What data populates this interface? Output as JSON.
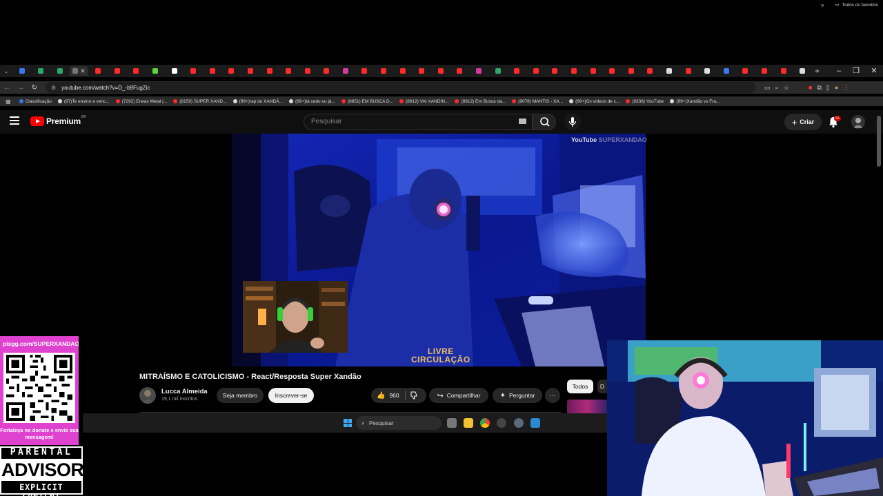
{
  "browser": {
    "tabs": [
      {
        "color": "#3a78f2"
      },
      {
        "color": "#2aa96a"
      },
      {
        "color": "#2aa96a"
      },
      {
        "color": "#777777",
        "active": true
      },
      {
        "color": "#ff2a2a"
      },
      {
        "color": "#ff2a2a"
      },
      {
        "color": "#ff2a2a"
      },
      {
        "color": "#5ed63a"
      },
      {
        "color": "#ffffff"
      },
      {
        "color": "#ff2a2a"
      },
      {
        "color": "#ff2a2a"
      },
      {
        "color": "#ff2a2a"
      },
      {
        "color": "#ff2a2a"
      },
      {
        "color": "#ff2a2a"
      },
      {
        "color": "#ff2a2a"
      },
      {
        "color": "#ff2a2a"
      },
      {
        "color": "#ff2a2a"
      },
      {
        "color": "#d63aa0"
      },
      {
        "color": "#ff2a2a"
      },
      {
        "color": "#ff2a2a"
      },
      {
        "color": "#ff2a2a"
      },
      {
        "color": "#ff2a2a"
      },
      {
        "color": "#ff2a2a"
      },
      {
        "color": "#ff2a2a"
      },
      {
        "color": "#d63aa0"
      },
      {
        "color": "#2aa96a"
      },
      {
        "color": "#ff2a2a"
      },
      {
        "color": "#ff2a2a"
      },
      {
        "color": "#ff2a2a"
      },
      {
        "color": "#ff2a2a"
      },
      {
        "color": "#ff2a2a"
      },
      {
        "color": "#ff2a2a"
      },
      {
        "color": "#ff2a2a"
      },
      {
        "color": "#ff2a2a"
      },
      {
        "color": "#dddddd"
      },
      {
        "color": "#ff2a2a"
      },
      {
        "color": "#dddddd"
      },
      {
        "color": "#3a78f2"
      },
      {
        "color": "#ff2a2a"
      },
      {
        "color": "#ff2a2a"
      },
      {
        "color": "#ff2a2a"
      },
      {
        "color": "#dddddd"
      }
    ],
    "new_tab": "+",
    "window": {
      "minimize": "–",
      "maximize": "❐",
      "close": "✕"
    },
    "url": "youtube.com/watch?v=D_-b9FugZic",
    "bookmarks": [
      {
        "label": "Classificação",
        "color": "#3a78f2"
      },
      {
        "label": "(97)Te ensino a venc...",
        "color": "#dddddd"
      },
      {
        "label": "(7292) Eneas Metal |...",
        "color": "#ff2a2a"
      },
      {
        "label": "(8159) SUPER XAND...",
        "color": "#ff2a2a"
      },
      {
        "label": "(99+)rap do XANDÃ...",
        "color": "#dddddd"
      },
      {
        "label": "(99+)tá cedo ou já...",
        "color": "#dddddd"
      },
      {
        "label": "(8851) EM BUSCA D...",
        "color": "#ff2a2a"
      },
      {
        "label": "(8912) VAI XANDIN...",
        "color": "#ff2a2a"
      },
      {
        "label": "(8912) Em Busca da...",
        "color": "#ff2a2a"
      },
      {
        "label": "(9078) MANTIS - XA...",
        "color": "#ff2a2a"
      },
      {
        "label": "(99+)Os vídeos de c...",
        "color": "#dddddd"
      },
      {
        "label": "(9338) YouTube",
        "color": "#ff2a2a"
      },
      {
        "label": "(99+)Xandão vs Fra...",
        "color": "#dddddd"
      }
    ],
    "bookmarks_more": "»",
    "all_bookmarks": "Todos os favoritos"
  },
  "youtube": {
    "logo_word": "Premium",
    "logo_region": "BR",
    "search_placeholder": "Pesquisar",
    "create_label": "Criar",
    "notifications_badge": "9+",
    "video_watermark_1": "You",
    "video_watermark_2": "Tube",
    "video_watermark_channel": "SUPERXANDAO",
    "video_overlay_line1": "LIVRE",
    "video_overlay_line2": "CIRCULAÇÃO",
    "video_title": "MITRAÍSMO E CATOLICISMO - React/Resposta Super Xandão",
    "channel_name": "Lucca Almeida",
    "subscribers": "19,1 mil inscritos",
    "join_label": "Seja membro",
    "subscribe_label": "Inscrever-se",
    "likes": "960",
    "share_label": "Compartilhar",
    "ask_label": "Perguntar",
    "chip_all": "Todos",
    "chip_next": "D"
  },
  "taskbar": {
    "search_label": "Pesquisar"
  },
  "overlay": {
    "pix_url": "pixgg.com/SUPERXANDAO",
    "pix_message": "Fortaleça no donate e envie sua mensagem!",
    "advisory_top": "PARENTAL",
    "advisory_mid": "ADVISORY",
    "advisory_bottom": "EXPLICIT CONTENT"
  }
}
